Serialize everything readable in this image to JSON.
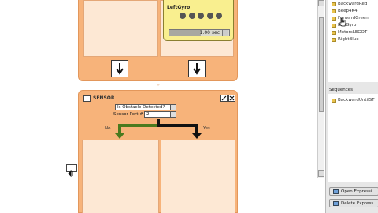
{
  "top_block": {
    "gyro": {
      "title": "LeftGyro",
      "time_value": "1.00 sec"
    }
  },
  "sensor": {
    "title": "SENSOR",
    "condition": "Is Obstacle Detected?",
    "port_label": "Sensor Port #",
    "port_value": "2",
    "no_label": "No",
    "yes_label": "Yes"
  },
  "sidebar": {
    "library_items": [
      {
        "label": "BackwardRed"
      },
      {
        "label": "Beep4K4"
      },
      {
        "label": "ForwardGreen"
      },
      {
        "label": "LeftGyro"
      },
      {
        "label": "MotorsLEGOT"
      },
      {
        "label": "RightBlue"
      }
    ],
    "sequences_label": "Sequences",
    "sequence_items": [
      {
        "label": "BackwardUntilST"
      }
    ],
    "open_button": "Open Expressi",
    "delete_button": "Delete Express"
  },
  "colors": {
    "block_orange": "#f7b37a",
    "lane_peach": "#fde8d4",
    "gyro_yellow": "#f9ef8f",
    "branch_green": "#4a7a1e",
    "branch_black": "#111111"
  },
  "icons": {
    "arrow": "down-arrow-icon",
    "folder": "folder-icon",
    "cursor": "hand-cursor-icon"
  }
}
